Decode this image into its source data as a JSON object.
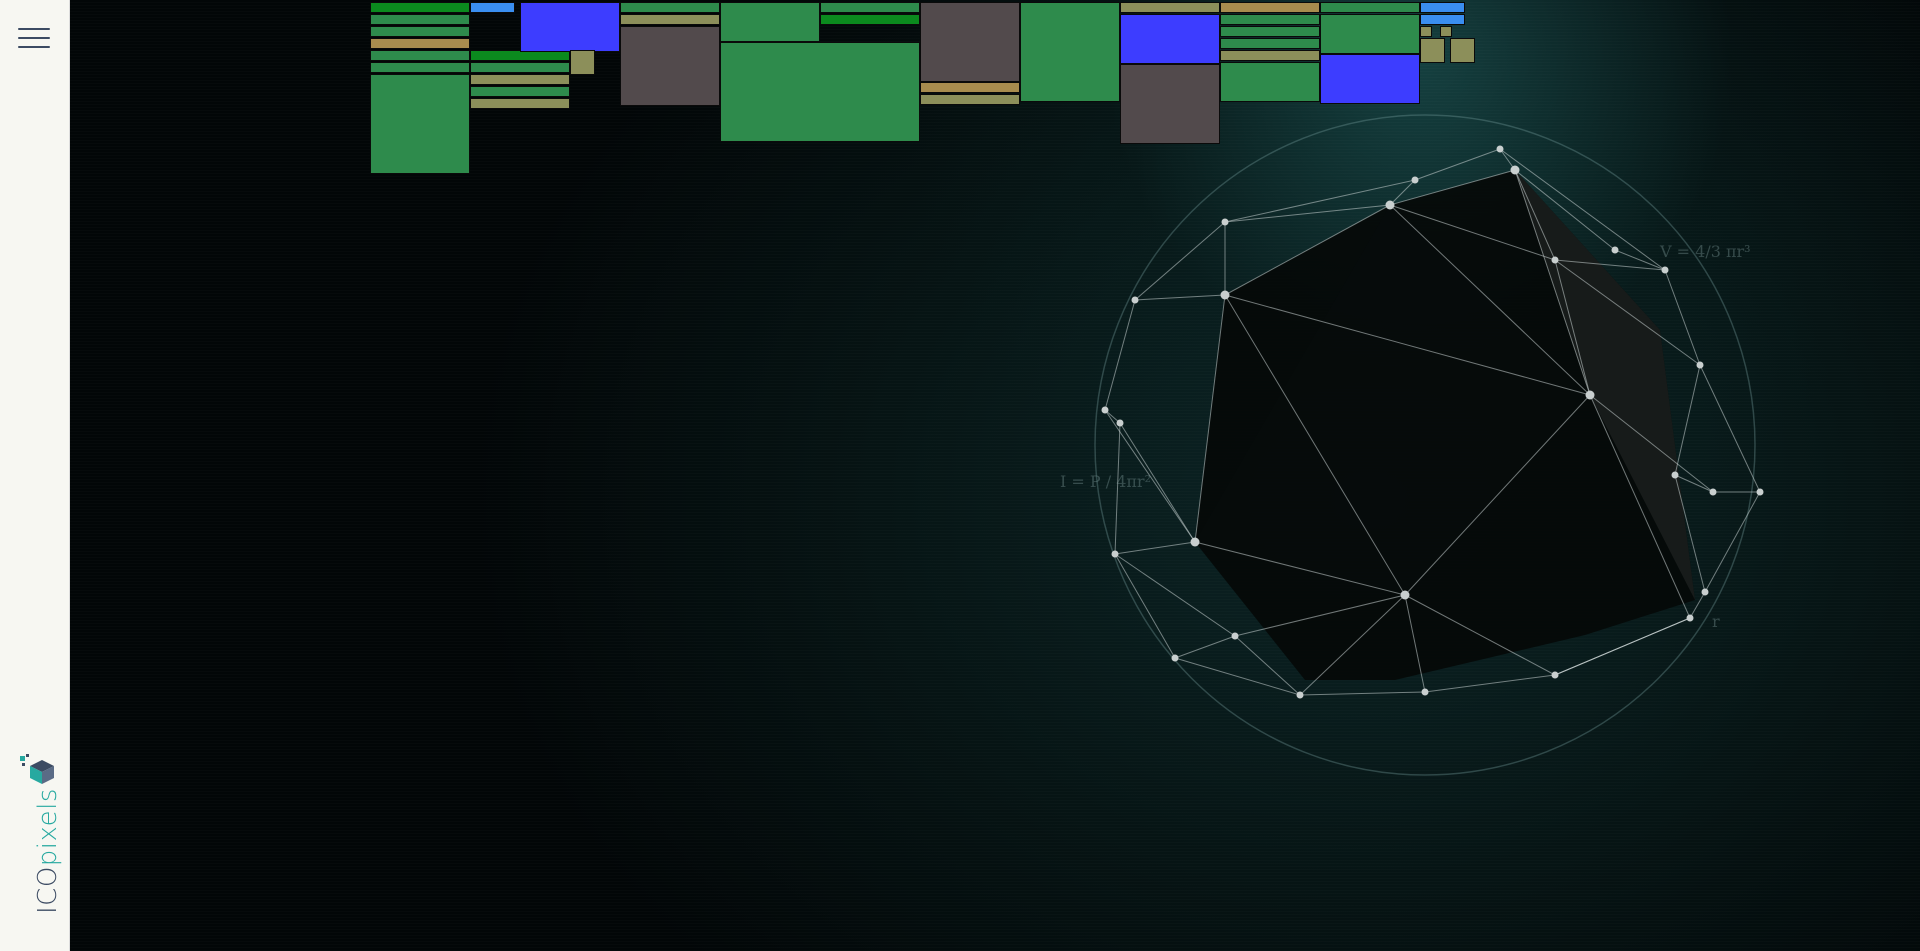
{
  "sidebar": {
    "menu_icon": "hamburger-menu-icon",
    "logo": {
      "part1": "ICO",
      "part2": "pixels",
      "icon": "cube-logo-icon"
    }
  },
  "colors": {
    "green": "#2e8b4c",
    "bright_green": "#0b8a1e",
    "olive": "#8c8f5a",
    "tan": "#a88c4e",
    "blue": "#3d3dff",
    "light_blue": "#3a8ef0",
    "taupe": "#524a4c"
  },
  "formulas": {
    "volume": "V = 4/3 πr³",
    "intensity": "I = P / 4πr²",
    "radius": "r"
  }
}
